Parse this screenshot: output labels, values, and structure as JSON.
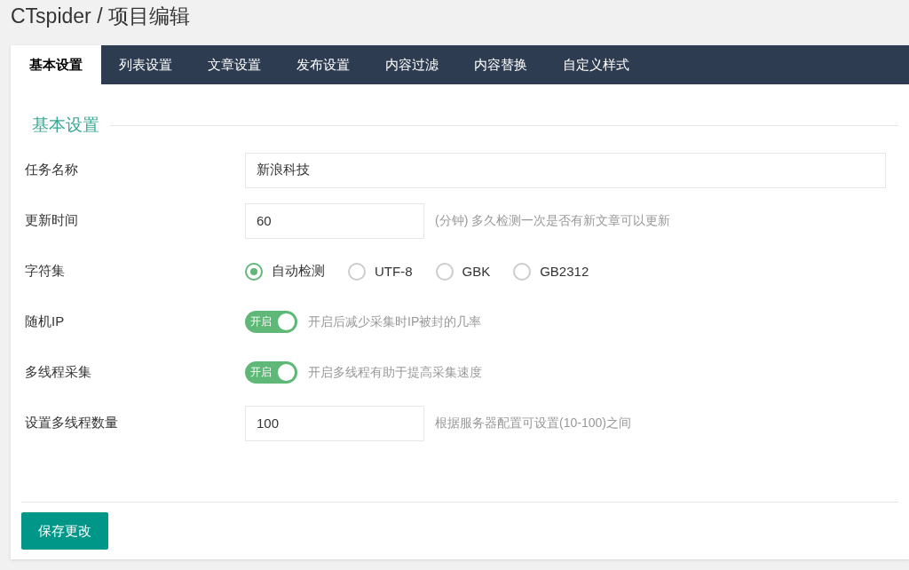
{
  "title": "CTspider / 项目编辑",
  "tabs": [
    {
      "label": "基本设置",
      "selected": true
    },
    {
      "label": "列表设置",
      "selected": false
    },
    {
      "label": "文章设置",
      "selected": false
    },
    {
      "label": "发布设置",
      "selected": false
    },
    {
      "label": "内容过滤",
      "selected": false
    },
    {
      "label": "内容替换",
      "selected": false
    },
    {
      "label": "自定义样式",
      "selected": false
    }
  ],
  "section": {
    "legend": "基本设置"
  },
  "fields": [
    {
      "kind": "text",
      "label": "任务名称",
      "value": "新浪科技"
    },
    {
      "kind": "text",
      "label": "更新时间",
      "value": "60",
      "hint": "(分钟) 多久检测一次是否有新文章可以更新"
    },
    {
      "kind": "radio",
      "label": "字符集",
      "options": [
        {
          "label": "自动检测",
          "selected": true
        },
        {
          "label": "UTF-8",
          "selected": false
        },
        {
          "label": "GBK",
          "selected": false
        },
        {
          "label": "GB2312",
          "selected": false
        }
      ]
    },
    {
      "kind": "toggle",
      "label": "随机IP",
      "on": true,
      "switch_text": "开启",
      "hint": "开启后减少采集时IP被封的几率"
    },
    {
      "kind": "toggle",
      "label": "多线程采集",
      "on": true,
      "switch_text": "开启",
      "hint": "开启多线程有助于提高采集速度"
    },
    {
      "kind": "text",
      "label": "设置多线程数量",
      "value": "100",
      "hint": "根据服务器配置可设置(10-100)之间"
    }
  ],
  "save_button": "保存更改"
}
